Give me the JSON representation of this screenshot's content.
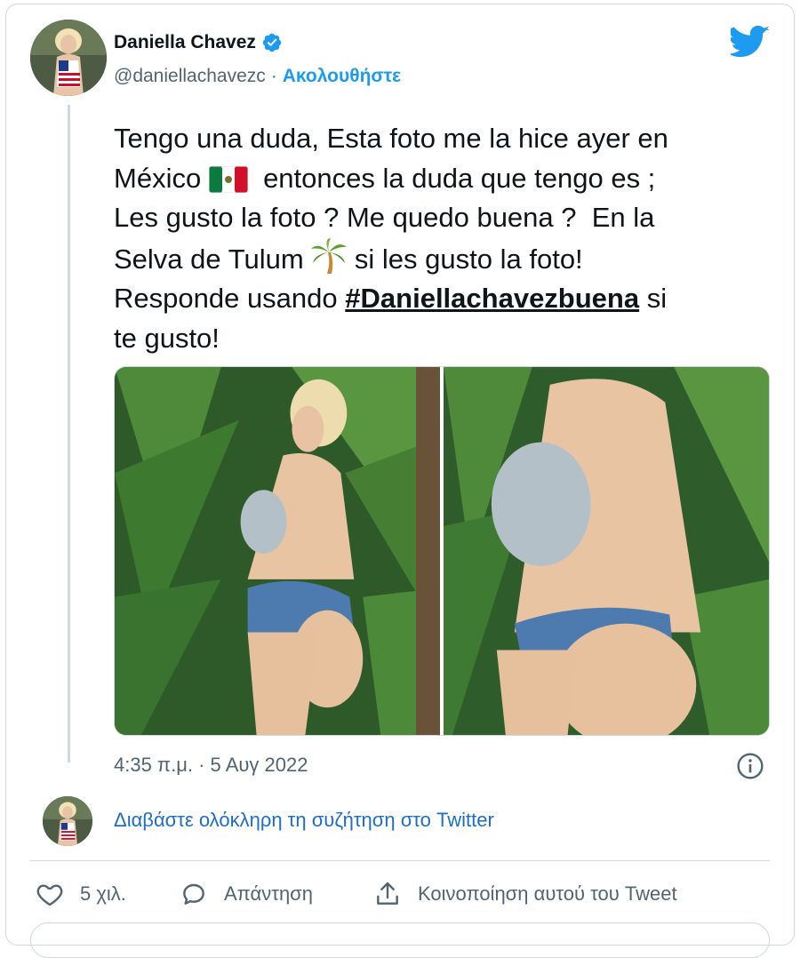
{
  "author": {
    "display_name": "Daniella Chavez",
    "handle": "@daniellachavezc",
    "separator": "·",
    "follow_label": "Ακολουθήστε"
  },
  "tweet": {
    "line1": "Tengo una duda, Esta foto me la hice ayer en",
    "line2a": "México",
    "line2b": "entonces la duda que tengo es ;",
    "line3": "Les gusto la foto ? Me quedo buena ?  En la",
    "line4a": "Selva de Tulum",
    "line4b": "si les gusto la foto!",
    "line5a": "Responde usando",
    "hashtag": "#Daniellachavezbuena",
    "line5b": "si",
    "line6": "te gusto!"
  },
  "timestamp": "4:35 π.μ. · 5 Αυγ 2022",
  "read_conversation": "Διαβάστε ολόκληρη τη συζήτηση στο Twitter",
  "actions": {
    "likes": "5 χιλ.",
    "reply": "Απάντηση",
    "share": "Κοινοποίηση αυτού του Tweet"
  },
  "colors": {
    "accent": "#1d9bf0",
    "link": "#1d6ec9",
    "muted": "#536471",
    "border": "#cfd9de"
  },
  "icons": [
    "verified-badge-icon",
    "twitter-bird-icon",
    "mexico-flag-icon",
    "palm-tree-icon",
    "info-icon",
    "heart-icon",
    "reply-icon",
    "share-icon"
  ]
}
